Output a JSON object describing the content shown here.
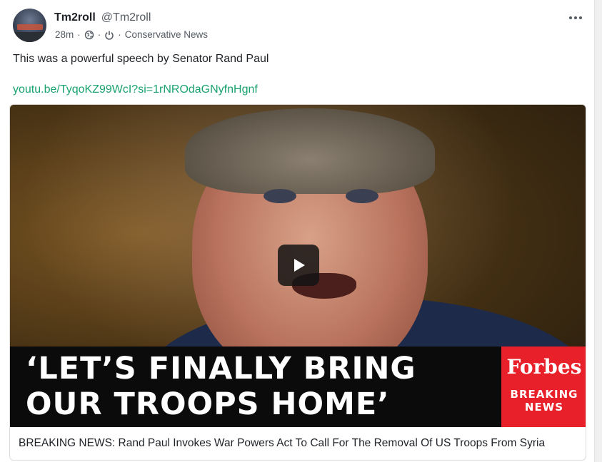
{
  "post": {
    "author_name": "Tm2roll",
    "author_handle": "@Tm2roll",
    "time_ago": "28m",
    "separator": "·",
    "community": "Conservative News",
    "body_text": "This was a powerful speech by Senator Rand Paul",
    "link_text": "youtu.be/TyqoKZ99WcI?si=1rNROdaGNyfnHgnf",
    "colors": {
      "link": "#1aa36f",
      "brand_red": "#e8202a"
    }
  },
  "embed": {
    "thumbnail_headline_line1": "‘LET’S FINALLY BRING",
    "thumbnail_headline_line2": "OUR TROOPS HOME’",
    "brand_name": "Forbes",
    "brand_tag": "BREAKING\nNEWS",
    "caption": "BREAKING NEWS: Rand Paul Invokes War Powers Act To Call For The Removal Of US Troops From Syria",
    "play_icon": "play-icon"
  },
  "icons": {
    "globe": "globe-icon",
    "power": "power-icon",
    "more": "more-options-icon"
  }
}
